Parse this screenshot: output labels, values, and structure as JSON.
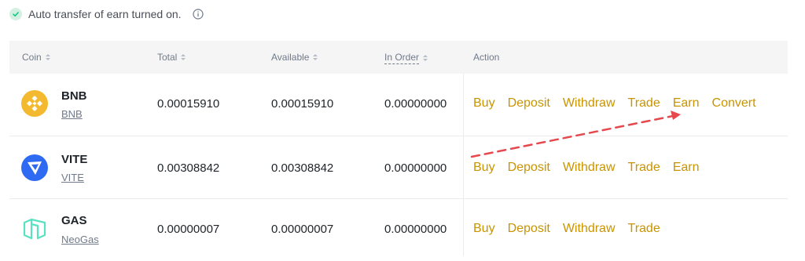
{
  "notice": {
    "text": "Auto transfer of earn turned on.",
    "icon": "check-circle-icon",
    "info_icon": "info-icon",
    "color": "#0ecb81"
  },
  "table": {
    "headers": {
      "coin": "Coin",
      "total": "Total",
      "available": "Available",
      "in_order": "In Order",
      "action": "Action"
    },
    "rows": [
      {
        "symbol": "BNB",
        "name": "BNB",
        "total": "0.00015910",
        "available": "0.00015910",
        "in_order": "0.00000000",
        "actions": [
          "Buy",
          "Deposit",
          "Withdraw",
          "Trade",
          "Earn",
          "Convert"
        ]
      },
      {
        "symbol": "VITE",
        "name": "VITE",
        "total": "0.00308842",
        "available": "0.00308842",
        "in_order": "0.00000000",
        "actions": [
          "Buy",
          "Deposit",
          "Withdraw",
          "Trade",
          "Earn"
        ]
      },
      {
        "symbol": "GAS",
        "name": "NeoGas",
        "total": "0.00000007",
        "available": "0.00000007",
        "in_order": "0.00000000",
        "actions": [
          "Buy",
          "Deposit",
          "Withdraw",
          "Trade"
        ]
      }
    ]
  },
  "colors": {
    "action_link": "#c99400",
    "annotation_arrow": "#e5484d",
    "bnb": "#f3ba2f",
    "vite": "#2f6bf2",
    "gas": "#58e2c2"
  }
}
